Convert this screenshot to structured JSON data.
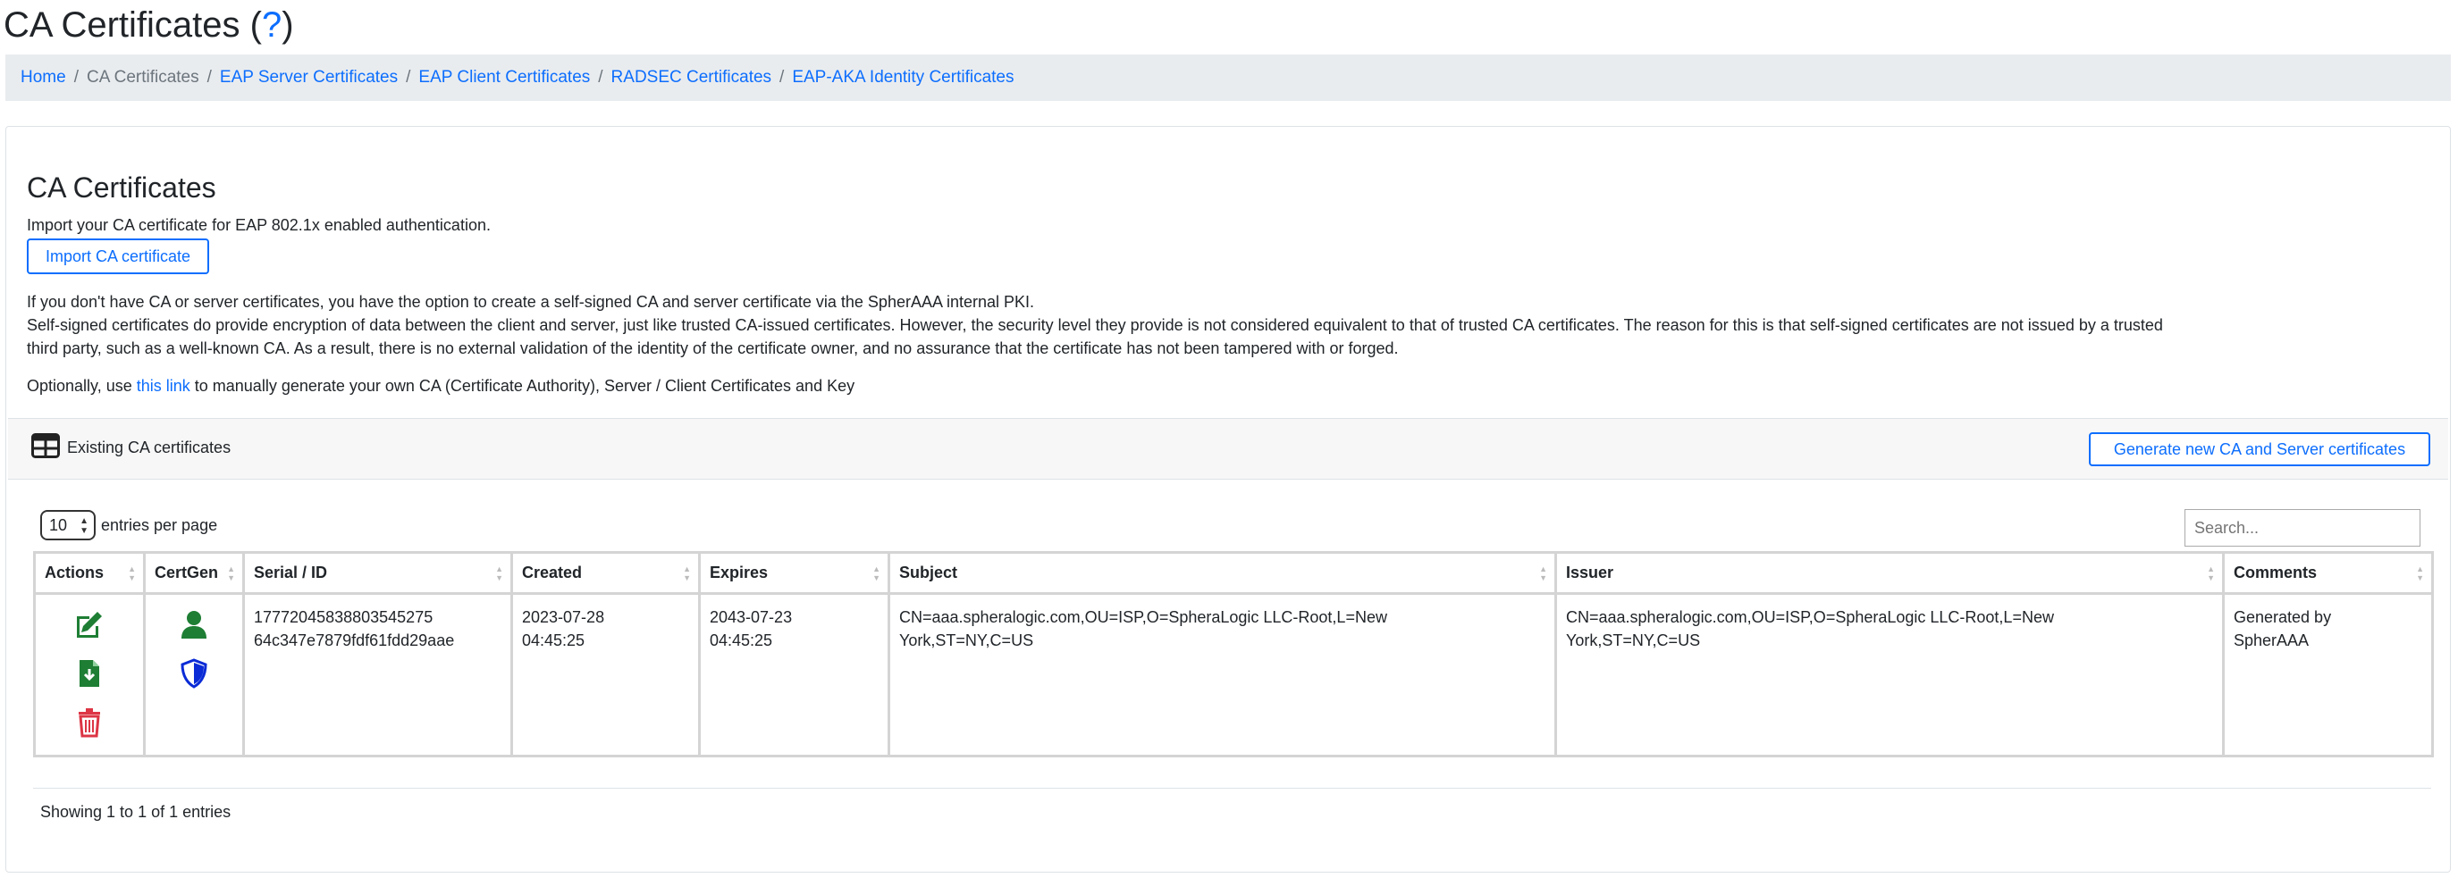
{
  "page": {
    "title": "CA Certificates (",
    "help": "?",
    "title_end": ")"
  },
  "breadcrumb": {
    "home": "Home",
    "current": "CA Certificates",
    "items": [
      "EAP Server Certificates",
      "EAP Client Certificates",
      "RADSEC Certificates",
      "EAP-AKA Identity Certificates"
    ],
    "separator": "/"
  },
  "card": {
    "title": "CA Certificates",
    "import_text": "Import your CA certificate for EAP 802.1x enabled authentication.",
    "import_button": "Import CA certificate",
    "info_line1": "If you don't have CA or server certificates, you have the option to create a self-signed CA and server certificate via the SpherAAA internal PKI.",
    "info_line2": "Self-signed certificates do provide encryption of data between the client and server, just like trusted CA-issued certificates. However, the security level they provide is not considered equivalent to that of trusted CA certificates. The reason for this is that self-signed certificates are not issued by a trusted",
    "info_line3": "third party, such as a well-known CA. As a result, there is no external validation of the identity of the certificate owner, and no assurance that the certificate has not been tampered with or forged.",
    "optional_prefix": "Optionally, use ",
    "optional_link": "this link",
    "optional_suffix": " to manually generate your own CA (Certificate Authority), Server / Client Certificates and Key"
  },
  "existing": {
    "header_label": "Existing CA certificates",
    "generate_button": "Generate new CA and Server certificates",
    "length_value": "10",
    "length_label": "entries per page",
    "search_placeholder": "Search...",
    "columns": [
      "Actions",
      "CertGen",
      "Serial / ID",
      "Created",
      "Expires",
      "Subject",
      "Issuer",
      "Comments"
    ],
    "rows": [
      {
        "serial": "17772045838803545275",
        "id": "64c347e7879fdf61fdd29aae",
        "created_date": "2023-07-28",
        "created_time": "04:45:25",
        "expires_date": "2043-07-23",
        "expires_time": "04:45:25",
        "subject_1": "CN=aaa.spheralogic.com,OU=ISP,O=SpheraLogic LLC-Root,L=New",
        "subject_2": "York,ST=NY,C=US",
        "issuer_1": "CN=aaa.spheralogic.com,OU=ISP,O=SpheraLogic LLC-Root,L=New",
        "issuer_2": "York,ST=NY,C=US",
        "comments_1": "Generated by",
        "comments_2": "SpherAAA"
      }
    ],
    "info": "Showing 1 to 1 of 1 entries"
  },
  "colors": {
    "link": "#0d6efd",
    "action_green": "#1e7e34",
    "action_red": "#dc3545",
    "shield_blue": "#0a2bd6"
  }
}
